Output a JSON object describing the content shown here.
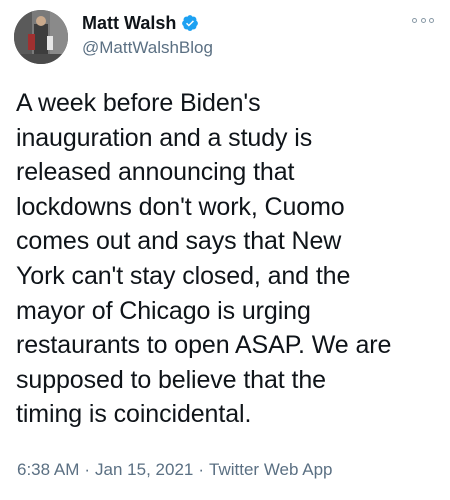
{
  "author": {
    "display_name": "Matt Walsh",
    "handle": "@MattWalshBlog",
    "verified": true,
    "avatar_icon": "profile-photo"
  },
  "tweet": {
    "text": "A week before Biden's\ninauguration and a study is\nreleased announcing that\nlockdowns don't work, Cuomo\ncomes out and says that New\nYork can't stay closed, and the\nmayor of Chicago is urging\nrestaurants to open ASAP. We are\nsupposed to believe that the\ntiming is coincidental."
  },
  "meta": {
    "time": "6:38 AM",
    "separator1": "·",
    "date": "Jan 15, 2021",
    "separator2": "·",
    "source": "Twitter Web App"
  },
  "colors": {
    "verified_blue": "#1da1f2",
    "secondary_text": "#5b7083",
    "primary_text": "#0f1419"
  },
  "icons": {
    "verified": "verified-badge-icon",
    "more": "more-options-icon"
  }
}
